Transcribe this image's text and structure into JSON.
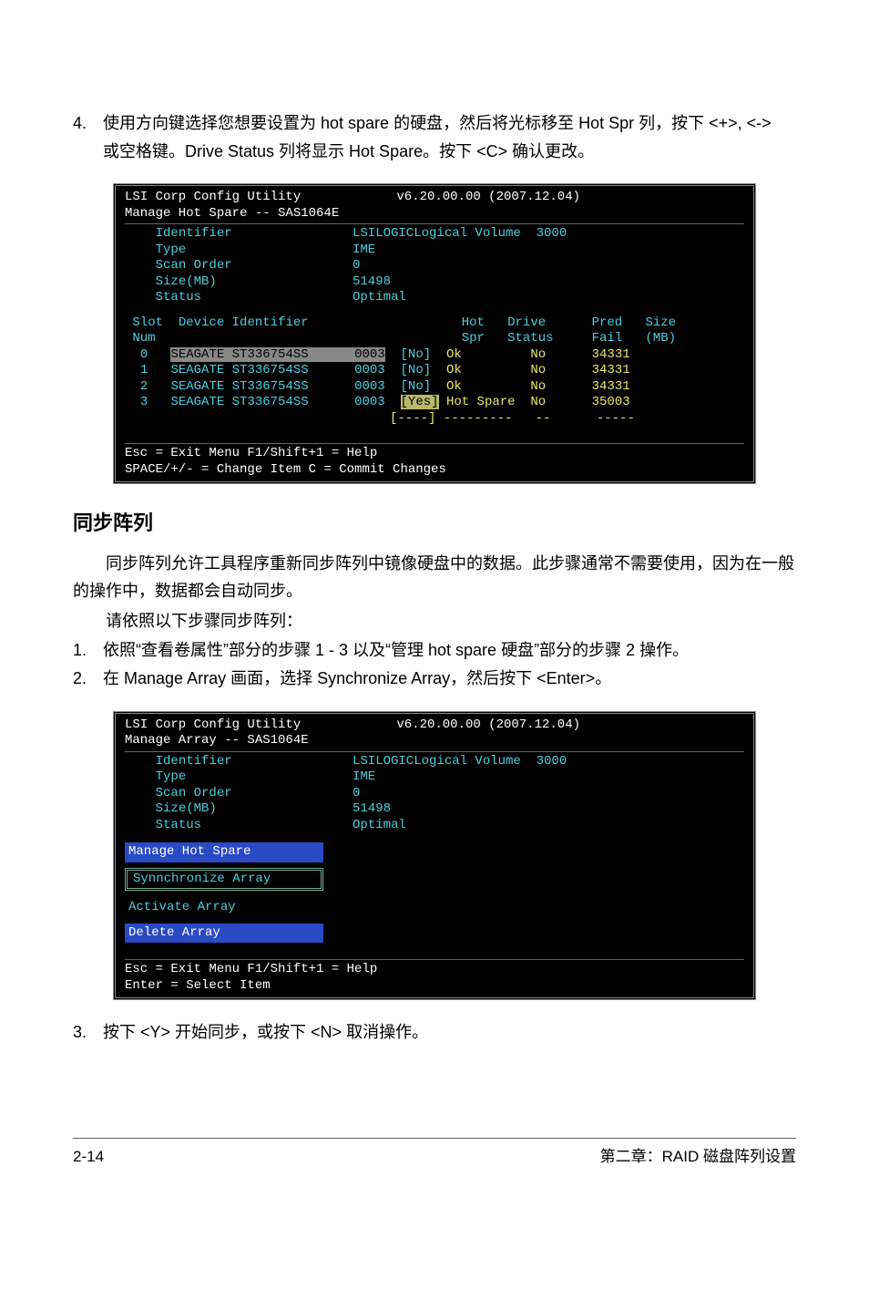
{
  "step4": {
    "num": "4.",
    "text": "使用方向键选择您想要设置为 hot spare 的硬盘，然后将光标移至 Hot Spr 列，按下 <+>, <-> 或空格键。Drive Status 列将显示 Hot Spare。按下 <C> 确认更改。"
  },
  "term1": {
    "title_left": "LSI Corp Config Utility",
    "title_right": "v6.20.00.00 (2007.12.04)",
    "subtitle": "Manage Hot Spare -- SAS1064E",
    "props": [
      {
        "label": "Identifier",
        "value": "LSILOGICLogical Volume  3000"
      },
      {
        "label": "Type",
        "value": "IME"
      },
      {
        "label": "Scan Order",
        "value": "0"
      },
      {
        "label": "Size(MB)",
        "value": "51498"
      },
      {
        "label": "Status",
        "value": "Optimal"
      }
    ],
    "headers": {
      "slot": "Slot",
      "num": "Num",
      "dev": "Device Identifier",
      "hot": "Hot",
      "spr": "Spr",
      "drv": "Drive",
      "stat": "Status",
      "pred": "Pred",
      "fail": "Fail",
      "size": "Size",
      "mb": "(MB)"
    },
    "rows": [
      {
        "n": "0",
        "dev": "SEAGATE ST336754SS",
        "rev": "0003",
        "hot": "[No]",
        "stat": "Ok",
        "pred": "No",
        "size": "34331",
        "sel": true
      },
      {
        "n": "1",
        "dev": "SEAGATE ST336754SS",
        "rev": "0003",
        "hot": "[No]",
        "stat": "Ok",
        "pred": "No",
        "size": "34331",
        "sel": false
      },
      {
        "n": "2",
        "dev": "SEAGATE ST336754SS",
        "rev": "0003",
        "hot": "[No]",
        "stat": "Ok",
        "pred": "No",
        "size": "34331",
        "sel": false
      },
      {
        "n": "3",
        "dev": "SEAGATE ST336754SS",
        "rev": "0003",
        "hot": "[Yes]",
        "stat": "Hot Spare",
        "pred": "No",
        "size": "35003",
        "sel": false,
        "hotsel": true
      }
    ],
    "dash": "[----] ---------   --      -----",
    "foot1": "Esc = Exit Menu   F1/Shift+1 = Help",
    "foot2": "SPACE/+/- = Change Item         C = Commit Changes"
  },
  "heading": "同步阵列",
  "para1": "同步阵列允许工具程序重新同步阵列中镜像硬盘中的数据。此步骤通常不需要使用，因为在一般的操作中，数据都会自动同步。",
  "para2": "请依照以下步骤同步阵列：",
  "step1b": {
    "num": "1.",
    "text": "依照“查看卷属性”部分的步骤 1 - 3 以及“管理 hot spare 硬盘”部分的步骤 2 操作。"
  },
  "step2b": {
    "num": "2.",
    "text": "在 Manage Array 画面，选择 Synchronize Array，然后按下 <Enter>。"
  },
  "term2": {
    "title_left": "LSI Corp Config Utility",
    "title_right": "v6.20.00.00 (2007.12.04)",
    "subtitle": "Manage Array -- SAS1064E",
    "props": [
      {
        "label": "Identifier",
        "value": "LSILOGICLogical Volume  3000"
      },
      {
        "label": "Type",
        "value": "IME"
      },
      {
        "label": "Scan Order",
        "value": "0"
      },
      {
        "label": "Size(MB)",
        "value": "51498"
      },
      {
        "label": "Status",
        "value": "Optimal"
      }
    ],
    "opts": [
      {
        "label": "Manage Hot Spare",
        "style": "bg"
      },
      {
        "label": "Synnchronize Array",
        "style": "sel"
      },
      {
        "label": "Activate Array",
        "style": "plain"
      },
      {
        "label": "Delete Array",
        "style": "bg"
      }
    ],
    "foot1": "Esc = Exit Menu          F1/Shift+1 = Help",
    "foot2": "Enter = Select Item"
  },
  "step3b": {
    "num": "3.",
    "text": "按下 <Y> 开始同步，或按下 <N> 取消操作。"
  },
  "footer_left": "2-14",
  "footer_right": "第二章：RAID 磁盘阵列设置"
}
